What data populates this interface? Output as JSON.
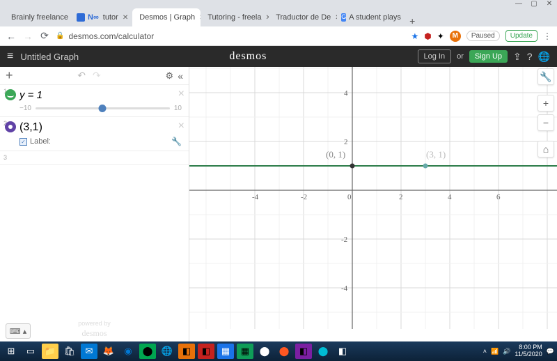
{
  "browser": {
    "tabs": [
      {
        "label": "Brainly freelance",
        "favicon": "#ff9d4d"
      },
      {
        "label": "tutor",
        "favicon": "#2e6bd6"
      },
      {
        "label": "Desmos | Graph",
        "favicon": "#3ba757",
        "active": true
      },
      {
        "label": "Tutoring - freela",
        "favicon": "#0f9d58"
      },
      {
        "label": "Traductor de De",
        "favicon": "#1a73e8"
      },
      {
        "label": "A student plays",
        "favicon": "#4285f4"
      }
    ],
    "url": "desmos.com/calculator",
    "avatar_letter": "M",
    "paused": "Paused",
    "update": "Update"
  },
  "header": {
    "title": "Untitled Graph",
    "brand": "desmos",
    "login": "Log In",
    "or": "or",
    "signup": "Sign Up"
  },
  "expressions": [
    {
      "index": "1",
      "display": "y = 1",
      "slider": {
        "min": "−10",
        "max": "10",
        "value": 1
      }
    },
    {
      "index": "2",
      "display": "(3,1)",
      "label_checked": true,
      "label_text": "Label:"
    },
    {
      "index": "3",
      "display": ""
    }
  ],
  "powered_by": "powered by\ndesmos",
  "chart_data": {
    "type": "line",
    "title": "",
    "xlabel": "",
    "ylabel": "",
    "xlim": [
      -4,
      6.5
    ],
    "ylim": [
      -4.5,
      4.5
    ],
    "x_ticks": [
      -4,
      -2,
      0,
      2,
      4,
      6
    ],
    "y_ticks": [
      -4,
      -2,
      0,
      2,
      4
    ],
    "series": [
      {
        "name": "y=1",
        "type": "hline",
        "y": 1,
        "color": "#2d7d4a"
      }
    ],
    "points": [
      {
        "x": 0,
        "y": 1,
        "label": "(0, 1)",
        "color": "#333"
      },
      {
        "x": 3,
        "y": 1,
        "label": "(3, 1)",
        "color": "#6aa"
      }
    ]
  },
  "taskbar": {
    "time": "8:00 PM",
    "date": "11/5/2020"
  }
}
